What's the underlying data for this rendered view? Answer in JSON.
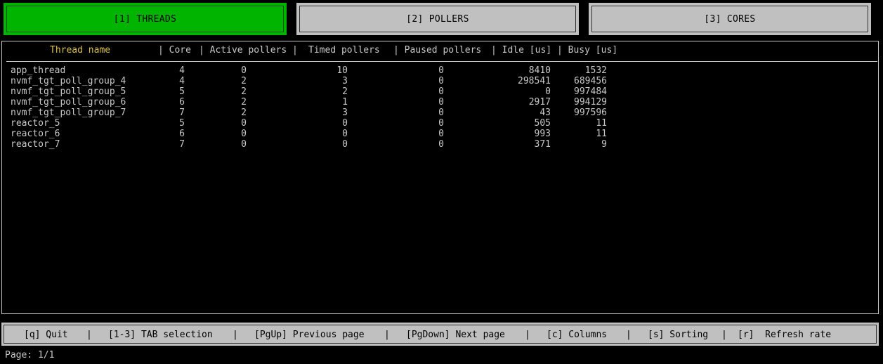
{
  "tabs": [
    {
      "label": "[1] THREADS",
      "active": true
    },
    {
      "label": "[2] POLLERS",
      "active": false
    },
    {
      "label": "[3] CORES",
      "active": false
    }
  ],
  "table": {
    "headers": {
      "thread_name": "Thread name",
      "core": "| Core",
      "active_pollers": "| Active pollers |",
      "timed_pollers": "Timed pollers",
      "paused_pollers": "| Paused pollers",
      "idle": "| Idle [us]",
      "busy": "| Busy [us]"
    },
    "rows": [
      {
        "name": "app_thread",
        "core": "4",
        "active": "0",
        "timed": "10",
        "paused": "0",
        "idle": "8410",
        "busy": "1532"
      },
      {
        "name": "nvmf_tgt_poll_group_4",
        "core": "4",
        "active": "2",
        "timed": "3",
        "paused": "0",
        "idle": "298541",
        "busy": "689456"
      },
      {
        "name": "nvmf_tgt_poll_group_5",
        "core": "5",
        "active": "2",
        "timed": "2",
        "paused": "0",
        "idle": "0",
        "busy": "997484"
      },
      {
        "name": "nvmf_tgt_poll_group_6",
        "core": "6",
        "active": "2",
        "timed": "1",
        "paused": "0",
        "idle": "2917",
        "busy": "994129"
      },
      {
        "name": "nvmf_tgt_poll_group_7",
        "core": "7",
        "active": "2",
        "timed": "3",
        "paused": "0",
        "idle": "43",
        "busy": "997596"
      },
      {
        "name": "reactor_5",
        "core": "5",
        "active": "0",
        "timed": "0",
        "paused": "0",
        "idle": "505",
        "busy": "11"
      },
      {
        "name": "reactor_6",
        "core": "6",
        "active": "0",
        "timed": "0",
        "paused": "0",
        "idle": "993",
        "busy": "11"
      },
      {
        "name": "reactor_7",
        "core": "7",
        "active": "0",
        "timed": "0",
        "paused": "0",
        "idle": "371",
        "busy": "9"
      }
    ]
  },
  "footer": {
    "quit": "[q] Quit",
    "tab_selection": "[1-3] TAB selection",
    "prev_page": "[PgUp] Previous page",
    "next_page": "[PgDown] Next page",
    "columns": "[c] Columns",
    "sorting": "[s] Sorting",
    "refresh": "[r]  Refresh rate",
    "separator": "|"
  },
  "page_indicator": "Page: 1/1",
  "colors": {
    "active_tab": "#00b400",
    "tab_bg": "#c0c0c0",
    "header_highlight": "#d8c048",
    "text": "#c8c8c8",
    "background": "#000000"
  }
}
